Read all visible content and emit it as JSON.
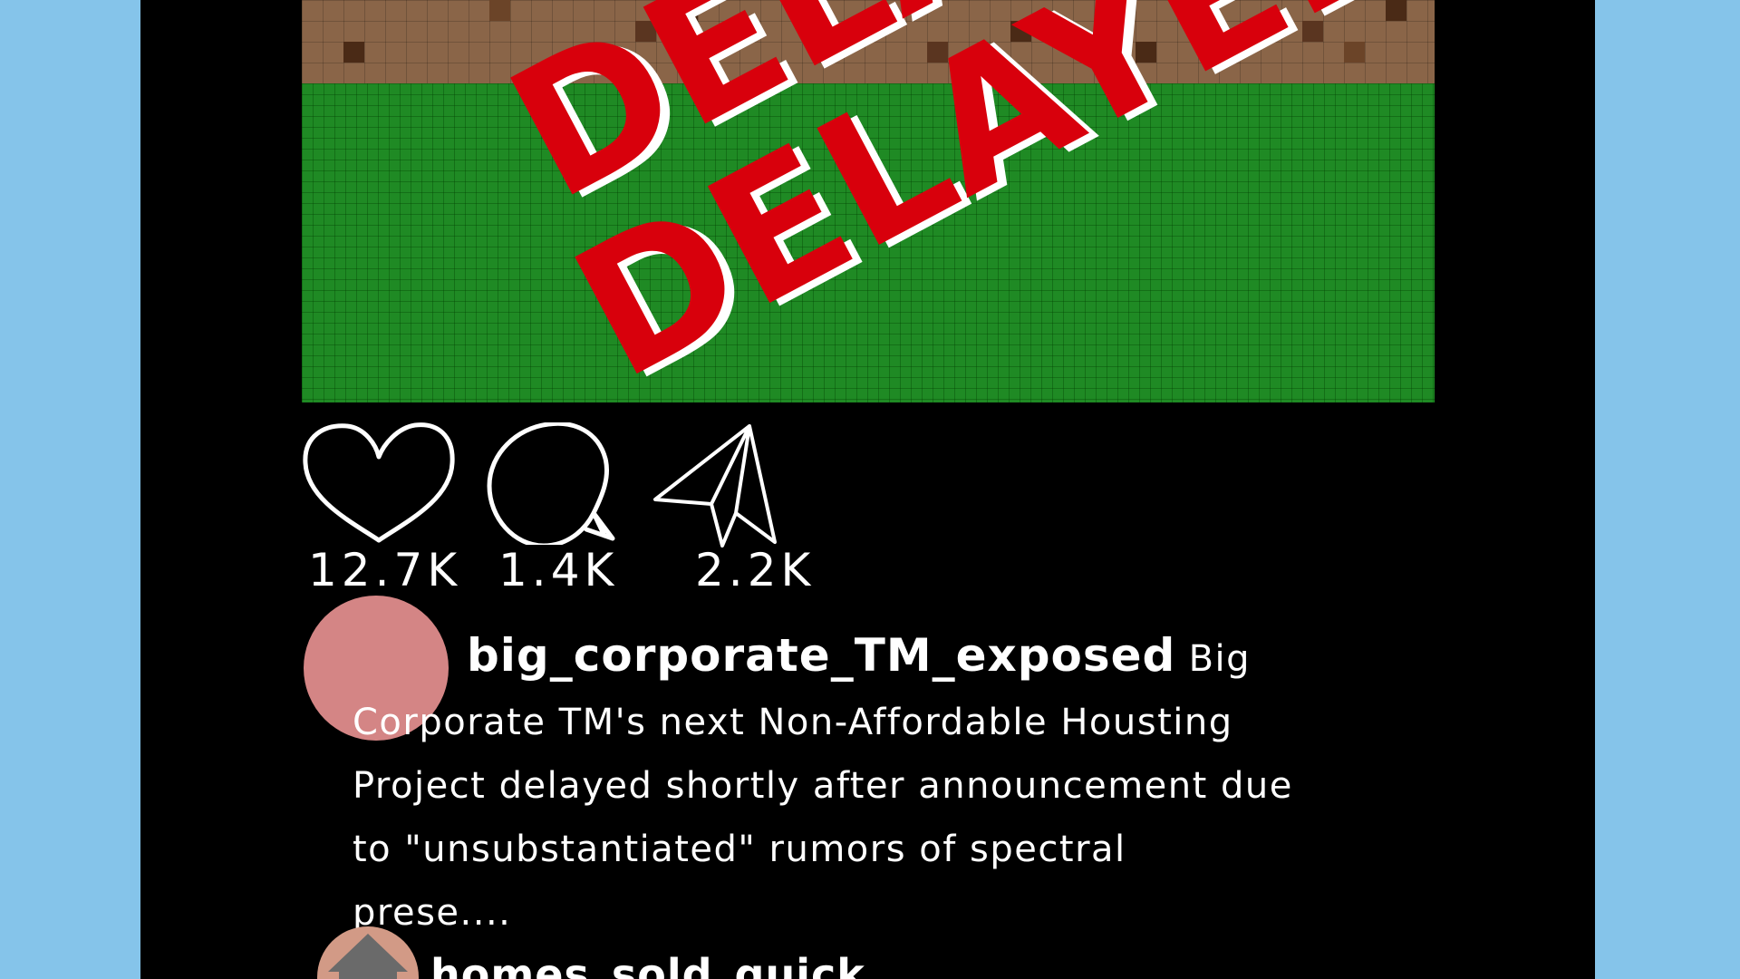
{
  "post": {
    "image": {
      "stamp_text_upper": "DELAYED",
      "stamp_text_lower": "DELAYED",
      "stamp_color": "#d8000c",
      "grass_color": "#1f8a24",
      "dirt_color": "#8a6548"
    },
    "actions": {
      "like": {
        "icon": "heart-icon",
        "count": "12.7K"
      },
      "comment": {
        "icon": "speech-bubble-icon",
        "count": "1.4K"
      },
      "share": {
        "icon": "paper-plane-icon",
        "count": "2.2K"
      }
    },
    "caption": {
      "username": "big_corporate_TM_exposed",
      "text": "Big Corporate TM's next Non-Affordable Housting Project delayed shortly after announcement due to \"unsubstantiated\" rumors of spectral prese...."
    }
  },
  "next_post": {
    "username": "homes_sold_quick",
    "avatar_icon": "house-icon"
  },
  "colors": {
    "background": "#85c4ea",
    "phone": "#000000",
    "avatar": "#d48585",
    "avatar2": "#d29a86"
  }
}
